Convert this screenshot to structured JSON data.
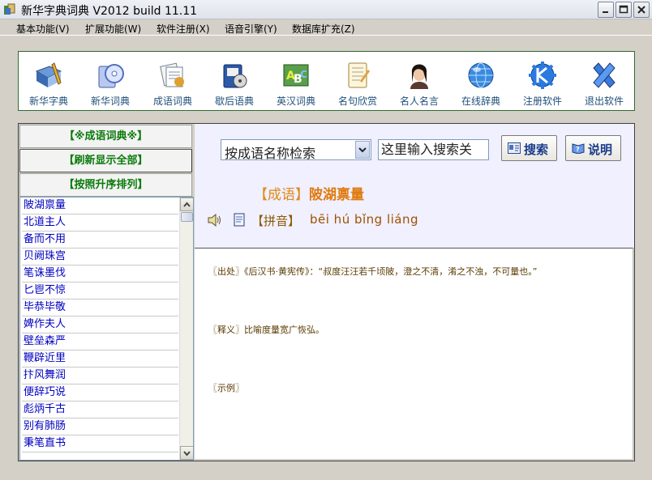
{
  "window": {
    "title": "新华字典词典 V2012 build 11.11"
  },
  "menu": [
    {
      "label": "基本功能(V)"
    },
    {
      "label": "扩展功能(W)"
    },
    {
      "label": "软件注册(X)"
    },
    {
      "label": "语音引擎(Y)"
    },
    {
      "label": "数据库扩充(Z)"
    }
  ],
  "toolbar": [
    {
      "label": "新华字典",
      "icon": "book-pen-icon"
    },
    {
      "label": "新华词典",
      "icon": "cd-book-icon"
    },
    {
      "label": "成语词典",
      "icon": "papers-icon"
    },
    {
      "label": "歇后语典",
      "icon": "disk-book-icon"
    },
    {
      "label": "英汉词典",
      "icon": "abc-icon"
    },
    {
      "label": "名句欣赏",
      "icon": "notebook-icon"
    },
    {
      "label": "名人名言",
      "icon": "portrait-icon"
    },
    {
      "label": "在线辞典",
      "icon": "globe-icon"
    },
    {
      "label": "注册软件",
      "icon": "kde-gear-icon"
    },
    {
      "label": "退出软件",
      "icon": "exit-x-icon"
    }
  ],
  "left": {
    "title_button": "【※成语词典※】",
    "refresh_button": "【刷新显示全部】",
    "sort_button": "【按照升序排列】",
    "items": [
      "陂湖禀量",
      "北道主人",
      "备而不用",
      "贝阙珠宫",
      "笔诛墨伐",
      "匕鬯不惊",
      "毕恭毕敬",
      "婢作夫人",
      "壁垒森严",
      "鞭辟近里",
      "抃风舞润",
      "便辞巧说",
      "彪炳千古",
      "别有肺肠",
      "秉笔直书"
    ]
  },
  "search": {
    "mode": "按成语名称检索",
    "input_value": "这里输入搜索关",
    "search_button": "搜索",
    "help_button": "说明"
  },
  "entry": {
    "kind_label": "【成语】",
    "word": "陂湖禀量",
    "pinyin_label": "【拼音】",
    "pinyin": "bēi hú bǐng liáng",
    "source": "〖出处〗《后汉书·黄宪传》：“叔度汪汪若千顷陂，澄之不清，淆之不浊，不可量也。”",
    "meaning": "〖释义〗比喻度量宽广恢弘。",
    "example": "〖示例〗"
  },
  "colors": {
    "accent_green": "#0a7a0a",
    "list_blue": "#0000c0",
    "title_orange": "#e07a10"
  }
}
